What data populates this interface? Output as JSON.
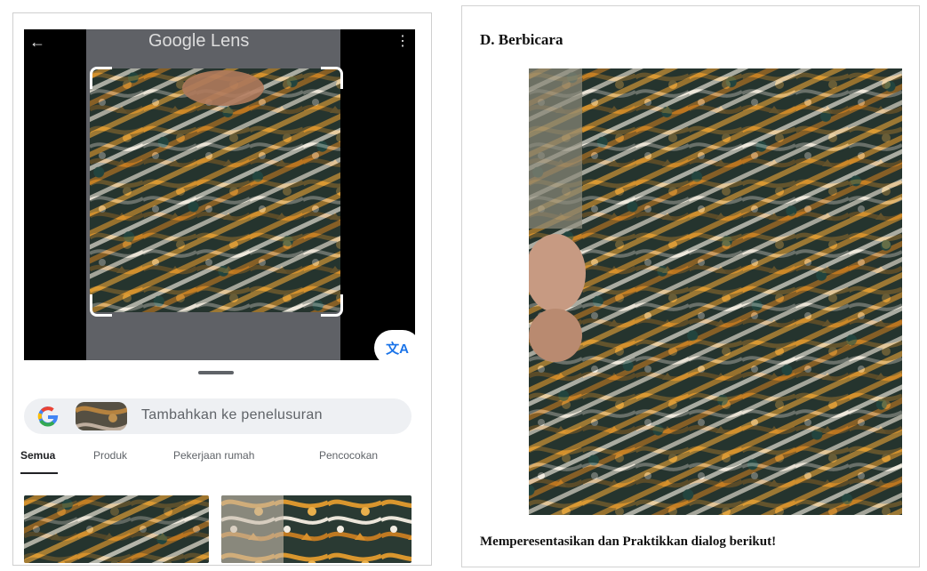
{
  "lens": {
    "title": "Google Lens",
    "back_icon": "back-arrow-icon",
    "menu_icon": "more-vert-icon",
    "translate_icon": "translate-icon",
    "search": {
      "logo_letter": "G",
      "label": "Tambahkan ke penelusuran"
    },
    "tabs": [
      {
        "label": "Semua",
        "active": true
      },
      {
        "label": "Produk",
        "active": false
      },
      {
        "label": "Pekerjaan rumah",
        "active": false
      },
      {
        "label": "Pencocokan",
        "active": false
      }
    ]
  },
  "document": {
    "section_heading": "D.   Berbicara",
    "instruction": "Memperesentasikan dan Praktikkan dialog berikut!"
  },
  "colors": {
    "accent": "#1a73e8",
    "batik_dark": "#1f2e2a",
    "batik_gold": "#c98a2b",
    "batik_light": "#e8e2d6"
  }
}
